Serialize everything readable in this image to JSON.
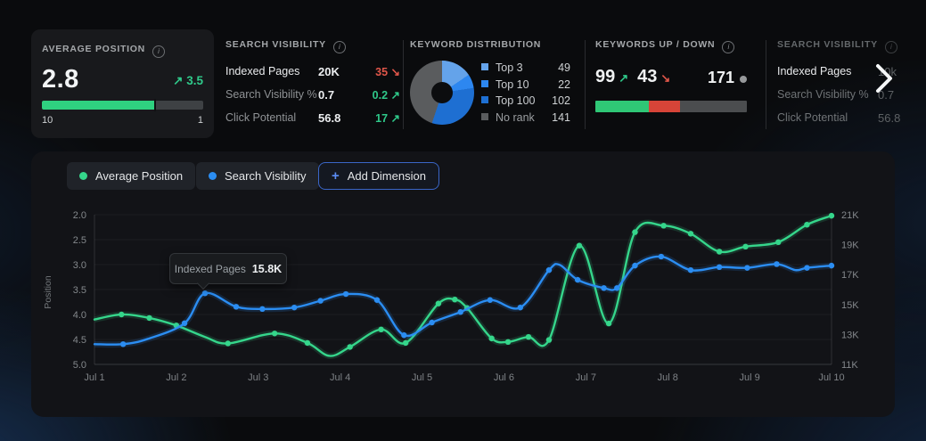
{
  "cards": {
    "average_position": {
      "title": "AVERAGE POSITION",
      "value": "2.8",
      "delta": "3.5",
      "delta_arrow": "↗",
      "delta_color": "#2fc98a",
      "bar_fill": "70%",
      "bar_color": "#2fd180",
      "scale_left": "10",
      "scale_right": "1"
    },
    "search_visibility": {
      "title": "SEARCH VISIBILITY",
      "rows": [
        {
          "label": "Indexed Pages",
          "value": "20K",
          "delta": "35",
          "arrow": "↘",
          "delta_color": "#e0564a"
        },
        {
          "label": "Search Visibility %",
          "value": "0.7",
          "delta": "0.2",
          "arrow": "↗",
          "delta_color": "#2fc98a"
        },
        {
          "label": "Click Potential",
          "value": "56.8",
          "delta": "17",
          "arrow": "↗",
          "delta_color": "#2fc98a"
        }
      ]
    },
    "keyword_distribution": {
      "title": "KEYWORD DISTRIBUTION",
      "segments": [
        {
          "label": "Top 3",
          "value": 49,
          "color": "#64a3ea"
        },
        {
          "label": "Top 10",
          "value": 22,
          "color": "#2d87f0"
        },
        {
          "label": "Top 100",
          "value": 102,
          "color": "#1e6fd2"
        },
        {
          "label": "No rank",
          "value": 141,
          "color": "#5a5c5e"
        }
      ]
    },
    "keywords_up_down": {
      "title": "KEYWORDS UP / DOWN",
      "up": "99",
      "up_arrow": "↗",
      "up_color": "#2fc98a",
      "down": "43",
      "down_arrow": "↘",
      "down_color": "#e0564a",
      "neutral": "171",
      "bar": [
        {
          "w": "35%",
          "color": "#2fc776"
        },
        {
          "w": "21%",
          "color": "#d64438"
        },
        {
          "w": "44%",
          "color": "#4b4d4f"
        }
      ]
    },
    "search_visibility_2": {
      "title": "SEARCH VISIBILITY",
      "rows": [
        {
          "label": "Indexed Pages",
          "value": "10k"
        },
        {
          "label": "Search Visibility %",
          "value": "0.7"
        },
        {
          "label": "Click Potential",
          "value": "56.8"
        }
      ]
    }
  },
  "legend_chips": [
    {
      "label": "Average Position",
      "color": "#35d68b"
    },
    {
      "label": "Search Visibility",
      "color": "#2b8df2"
    }
  ],
  "add_dimension_label": "Add Dimension",
  "add_dimension_plus": "+",
  "tooltip": {
    "label": "Indexed Pages",
    "value": "15.8K"
  },
  "chart_data": {
    "type": "line",
    "x_ticks": [
      "Jul 1",
      "Jul 2",
      "Jul 3",
      "Jul 4",
      "Jul 5",
      "Jul 6",
      "Jul 7",
      "Jul 8",
      "Jul 9",
      "Jul 10"
    ],
    "left_axis": {
      "label": "Position",
      "ticks": [
        2.0,
        2.5,
        3.0,
        3.5,
        4.0,
        4.5,
        5.0
      ],
      "range": [
        2.0,
        5.0
      ],
      "inverted": true
    },
    "right_axis": {
      "tick_labels": [
        "21K",
        "19K",
        "17K",
        "15K",
        "13K",
        "11K"
      ],
      "range": [
        11,
        21
      ],
      "unit": "K"
    },
    "grid": true,
    "series": [
      {
        "name": "Average Position",
        "axis": "left",
        "color": "#35d68b",
        "points": [
          [
            0,
            4.1,
            0
          ],
          [
            0.33,
            4.0
          ],
          [
            0.67,
            4.07
          ],
          [
            1.0,
            4.22
          ],
          [
            1.35,
            4.45,
            0
          ],
          [
            1.63,
            4.58
          ],
          [
            2.2,
            4.38
          ],
          [
            2.6,
            4.57
          ],
          [
            2.87,
            4.83,
            0
          ],
          [
            3.12,
            4.65
          ],
          [
            3.5,
            4.3
          ],
          [
            3.8,
            4.57
          ],
          [
            4.2,
            3.78
          ],
          [
            4.4,
            3.7
          ],
          [
            4.55,
            3.87
          ],
          [
            4.85,
            4.48
          ],
          [
            5.05,
            4.55
          ],
          [
            5.3,
            4.45
          ],
          [
            5.55,
            4.51
          ],
          [
            5.92,
            2.62
          ],
          [
            6.28,
            4.18
          ],
          [
            6.6,
            2.35
          ],
          [
            6.95,
            2.22
          ],
          [
            7.28,
            2.38
          ],
          [
            7.63,
            2.74
          ],
          [
            7.95,
            2.64
          ],
          [
            8.35,
            2.55
          ],
          [
            8.7,
            2.2
          ],
          [
            9.0,
            2.02
          ]
        ]
      },
      {
        "name": "Search Visibility",
        "axis": "right",
        "color": "#2b8df2",
        "points": [
          [
            0,
            12.35,
            0
          ],
          [
            0.35,
            12.35
          ],
          [
            0.65,
            12.7,
            0
          ],
          [
            1.1,
            13.75
          ],
          [
            1.35,
            15.75
          ],
          [
            1.73,
            14.85
          ],
          [
            2.05,
            14.7
          ],
          [
            2.44,
            14.8
          ],
          [
            2.76,
            15.25
          ],
          [
            3.07,
            15.7
          ],
          [
            3.45,
            15.3
          ],
          [
            3.78,
            12.95
          ],
          [
            4.12,
            13.8
          ],
          [
            4.47,
            14.5
          ],
          [
            4.83,
            15.3
          ],
          [
            5.2,
            14.8
          ],
          [
            5.55,
            17.3
          ],
          [
            5.68,
            17.65,
            0
          ],
          [
            5.9,
            16.65
          ],
          [
            6.22,
            16.1
          ],
          [
            6.38,
            16.1
          ],
          [
            6.6,
            17.6
          ],
          [
            6.92,
            18.2
          ],
          [
            7.28,
            17.3
          ],
          [
            7.63,
            17.5
          ],
          [
            7.97,
            17.45
          ],
          [
            8.33,
            17.7
          ],
          [
            8.56,
            17.3,
            0
          ],
          [
            8.7,
            17.45
          ],
          [
            9.0,
            17.6
          ]
        ]
      }
    ]
  }
}
